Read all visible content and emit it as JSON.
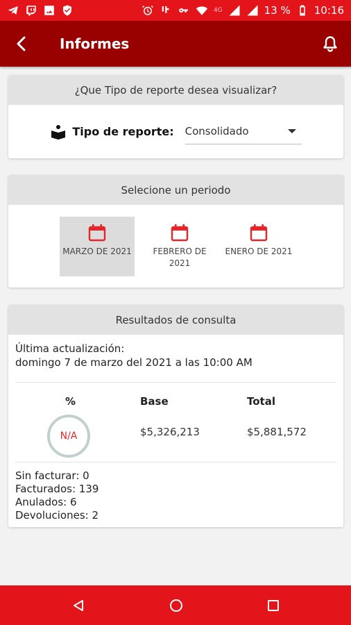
{
  "status_bar": {
    "battery_text": "13 %",
    "network_label": "4G",
    "time": "10:16",
    "left_icons": [
      "telegram-icon",
      "twitch-icon",
      "image-icon",
      "shield-icon"
    ],
    "right_icons": [
      "alarm-icon",
      "volte-icon",
      "key-icon",
      "wifi-icon",
      "signal-icon",
      "battery-icon"
    ]
  },
  "app_bar": {
    "title": "Informes",
    "back_icon": "chevron-left-icon",
    "bell_icon": "bell-icon",
    "background": "#990000"
  },
  "report_type": {
    "header": "¿Que Tipo de reporte desea visualizar?",
    "label": "Tipo de reporte:",
    "selected": "Consolidado"
  },
  "period": {
    "header": "Selecione un periodo",
    "items": [
      {
        "label": "MARZO DE 2021",
        "selected": true
      },
      {
        "label": "FEBRERO DE 2021",
        "selected": false
      },
      {
        "label": "ENERO DE 2021",
        "selected": false
      }
    ]
  },
  "results": {
    "header": "Resultados de consulta",
    "updated_label": "Última actualización:",
    "updated_value": "domingo 7 de marzo del 2021 a las 10:00 AM",
    "columns": {
      "percent": "%",
      "base": "Base",
      "total": "Total"
    },
    "percent_value": "N/A",
    "base_value": "$5,326,213",
    "total_value": "$5,881,572",
    "counts": [
      "Sin facturar: 0",
      "Facturados: 139",
      "Anulados: 6",
      "Devoluciones: 2"
    ]
  },
  "colors": {
    "accent_red": "#e4141b",
    "dark_red": "#990000",
    "header_gray": "#e2e2e2",
    "selected_gray": "#dcdcdc"
  },
  "nav_bar": {
    "buttons": [
      "back-triangle-icon",
      "home-circle-icon",
      "recents-square-icon"
    ]
  }
}
